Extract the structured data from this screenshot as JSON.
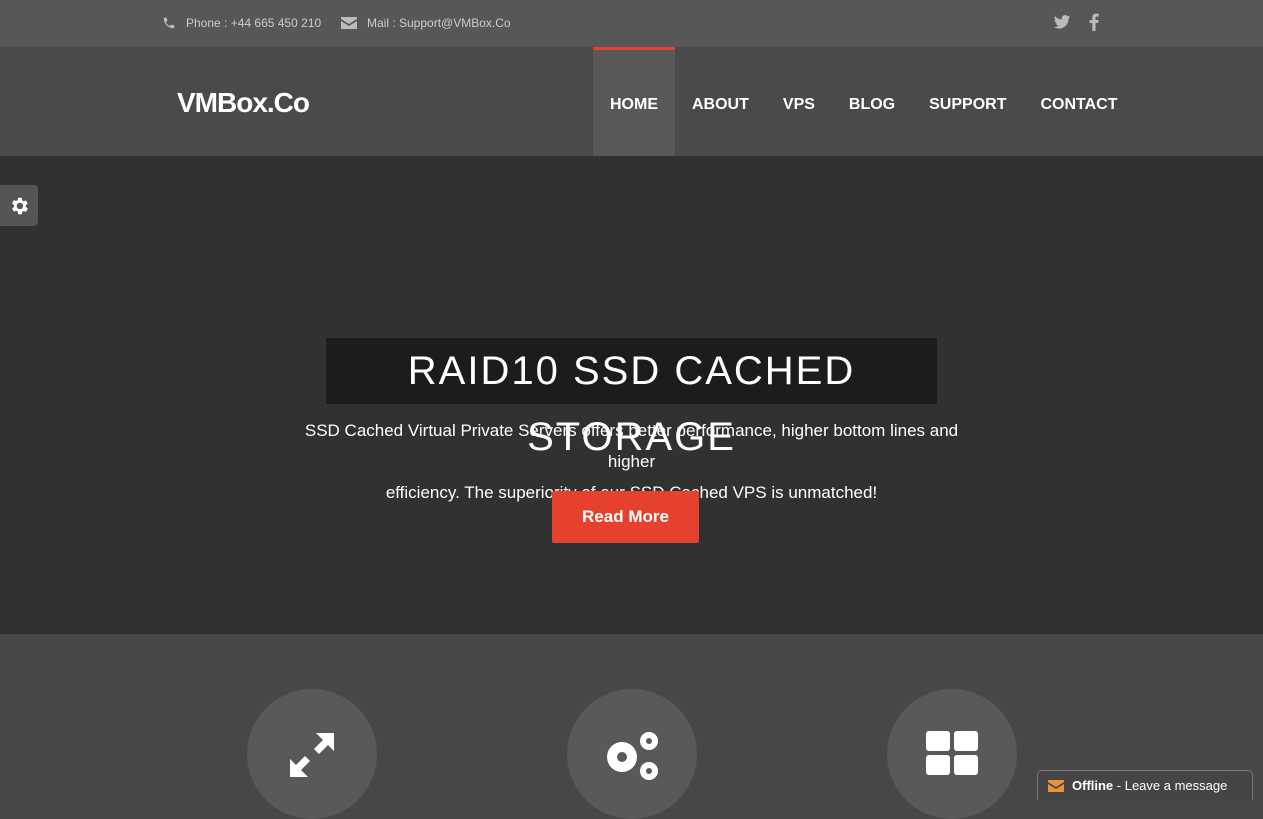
{
  "topbar": {
    "phone": "Phone : +44 665 450 210",
    "mail": "Mail : Support@VMBox.Co"
  },
  "logo": "VMBox.Co",
  "nav": [
    "HOME",
    "ABOUT",
    "VPS",
    "BLOG",
    "SUPPORT",
    "CONTACT"
  ],
  "hero": {
    "title": "RAID10 SSD CACHED STORAGE",
    "line1": "SSD Cached Virtual Private Servers offers better performance, higher bottom lines and higher",
    "line2": "efficiency. The superiority of our SSD Cached VPS is unmatched!",
    "button": "Read More"
  },
  "features": [
    {
      "icon": "expand-icon"
    },
    {
      "icon": "gears-icon"
    },
    {
      "icon": "grid-icon"
    }
  ],
  "chat": {
    "status": "Offline",
    "message": " - Leave a message"
  },
  "colors": {
    "accent": "#e5412d"
  }
}
